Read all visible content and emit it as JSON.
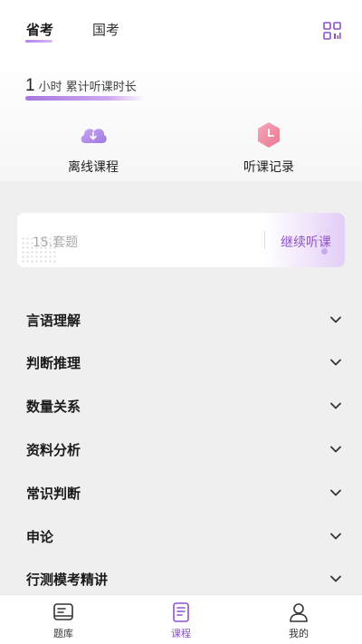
{
  "header": {
    "tabs": [
      {
        "label": "省考",
        "active": true
      },
      {
        "label": "国考",
        "active": false
      }
    ],
    "scan_icon": "qr-scan-icon"
  },
  "study": {
    "hours": "1",
    "hours_label": "小时 累计听课时长"
  },
  "quick_actions": [
    {
      "label": "离线课程",
      "icon": "cloud-download-icon"
    },
    {
      "label": "听课记录",
      "icon": "clock-record-icon"
    }
  ],
  "continue_card": {
    "title": "15.套题",
    "button": "继续听课"
  },
  "categories": [
    {
      "label": "言语理解"
    },
    {
      "label": "判断推理"
    },
    {
      "label": "数量关系"
    },
    {
      "label": "资料分析"
    },
    {
      "label": "常识判断"
    },
    {
      "label": "申论"
    },
    {
      "label": "行测模考精讲"
    }
  ],
  "bottom_nav": [
    {
      "label": "题库",
      "icon": "question-bank-icon",
      "active": false
    },
    {
      "label": "课程",
      "icon": "course-book-icon",
      "active": true
    },
    {
      "label": "我的",
      "icon": "profile-icon",
      "active": false
    }
  ],
  "colors": {
    "accent": "#8e52c9",
    "accent_light": "#c9a4f0",
    "background": "#efefef"
  }
}
